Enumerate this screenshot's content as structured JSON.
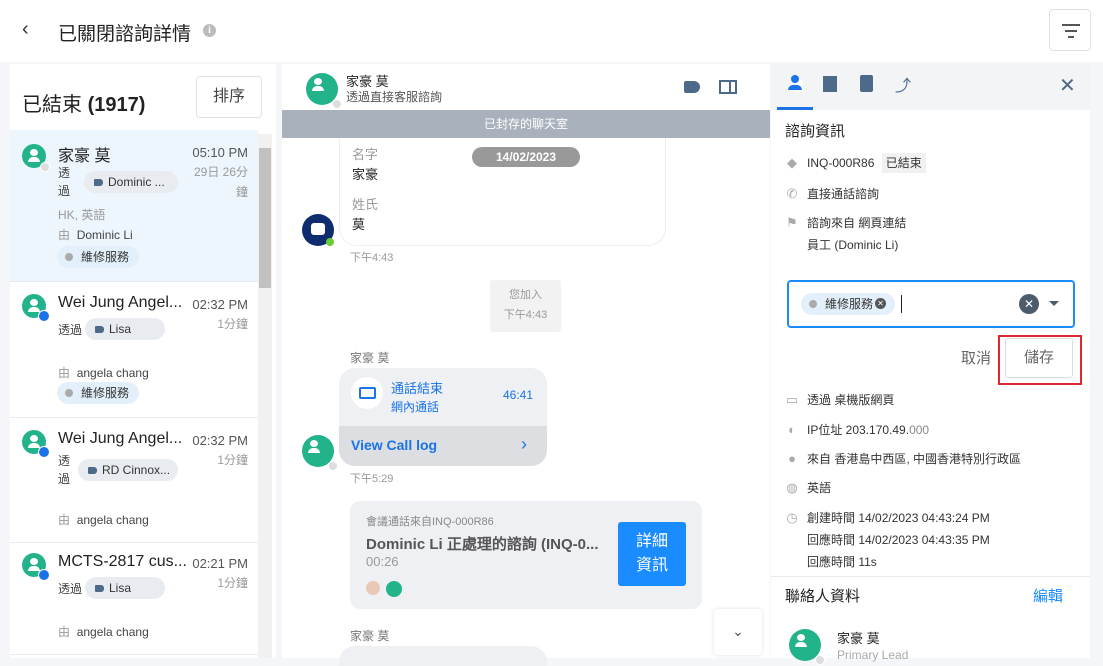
{
  "header": {
    "back": "‹",
    "title": "已關閉諮詢詳情",
    "info": "i"
  },
  "list": {
    "title": "已結束",
    "count": "(1917)",
    "sort": "排序",
    "items": [
      {
        "name": "家豪 莫",
        "time": "05:10 PM",
        "ago": "29日 26分",
        "ago2": "鐘",
        "via": "透",
        "via2": "過",
        "chip": "Dominic ...",
        "meta": "HK, 英語",
        "by": "由",
        "agent": "Dominic Li",
        "tag": "維修服務"
      },
      {
        "name": "Wei Jung Angel...",
        "time": "02:32 PM",
        "ago": "1分鐘",
        "via": "透過",
        "chip": "Lisa",
        "by": "由",
        "agent": "angela chang",
        "tag": "維修服務"
      },
      {
        "name": "Wei Jung Angel...",
        "time": "02:32 PM",
        "ago": "1分鐘",
        "via": "透",
        "via2": "過",
        "chip": "RD Cinnox...",
        "by": "由",
        "agent": "angela chang"
      },
      {
        "name": "MCTS-2817 cus...",
        "time": "02:21 PM",
        "ago": "1分鐘",
        "via": "透過",
        "chip": "Lisa",
        "by": "由",
        "agent": "angela chang"
      }
    ]
  },
  "chat": {
    "name": "家豪 莫",
    "subtitle": "透過直接客服諮詢",
    "banner": "已封存的聊天室",
    "date": "14/02/2023",
    "form": {
      "l1": "名字",
      "v1": "家豪",
      "l2": "姓氏",
      "v2": "莫"
    },
    "t1": "下午4:43",
    "join": "您加入",
    "join_time": "下午4:43",
    "sender": "家豪 莫",
    "call": {
      "title": "通話結束",
      "sub": "網內通話",
      "dur": "46:41",
      "link": "View Call log"
    },
    "t2": "下午5:29",
    "conf": {
      "from": "會議通話來自INQ-000R86",
      "title": "Dominic Li 正處理的諮詢 (INQ-0...",
      "dur": "00:26",
      "btn1": "詳細",
      "btn2": "資訊"
    },
    "sender2": "家豪 莫"
  },
  "panel": {
    "section": "諮詢資訊",
    "inq": "INQ-000R86",
    "status": "已結束",
    "type": "直接通話諮詢",
    "source": "諮詢來自 網頁連結",
    "staff": "員工 (Dominic Li)",
    "tag": "維修服務",
    "cancel": "取消",
    "save": "儲存",
    "device": "透過 桌機版網頁",
    "ip": "IP位址 203.170.49.",
    "ip2": "000",
    "loc": "來自 香港島中西區, 中國香港特別行政區",
    "lang": "英語",
    "created": "創建時間 14/02/2023 04:43:24 PM",
    "responded": "回應時間 14/02/2023 04:43:35 PM",
    "resp": "回應時間 11s",
    "contact": "聯絡人資料",
    "edit": "編輯",
    "cname": "家豪 莫",
    "crole": "Primary Lead"
  },
  "colors": {
    "accent": "#1a8cff",
    "green": "#22b38a",
    "highlight": "#e0262e"
  }
}
